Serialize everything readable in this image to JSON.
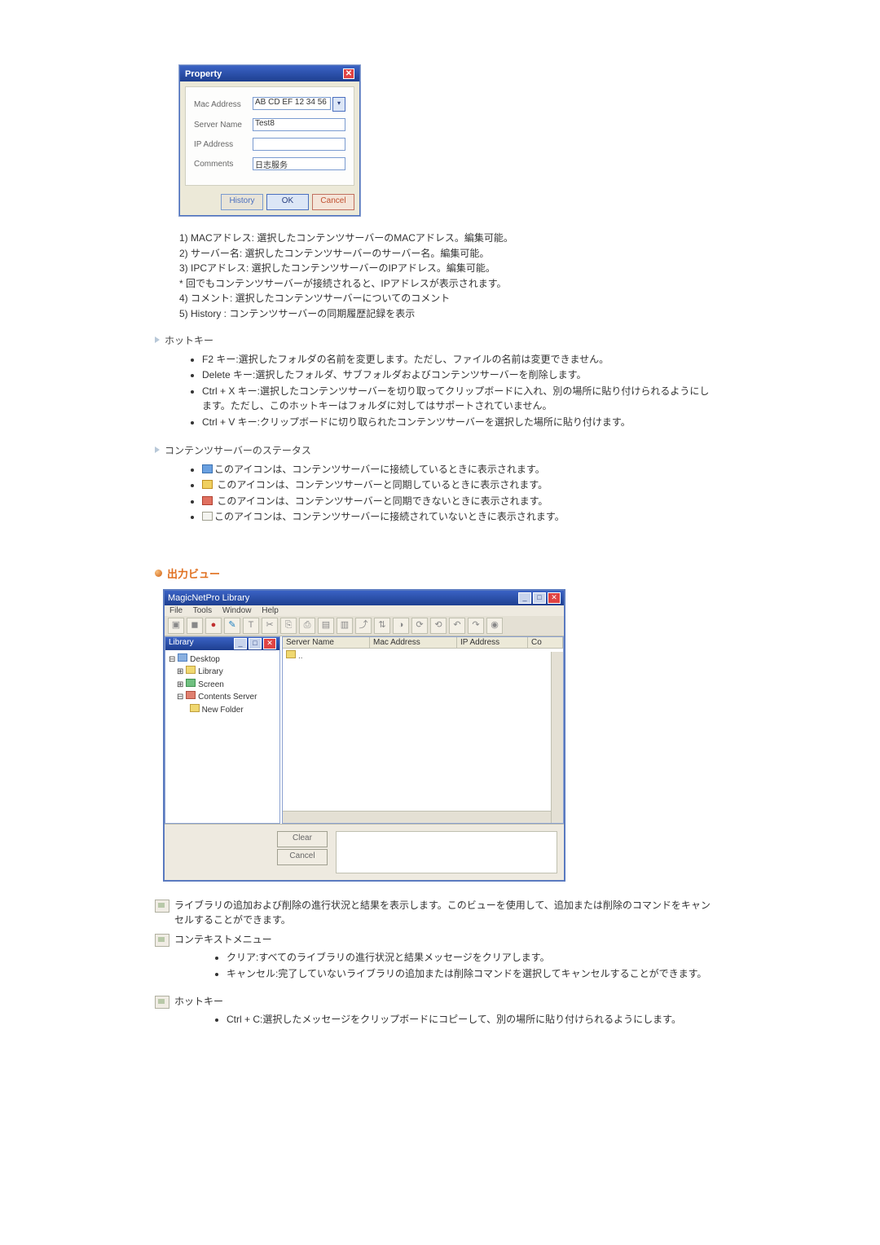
{
  "property_dialog": {
    "title": "Property",
    "rows": {
      "mac_label": "Mac Address",
      "mac_value": "AB CD EF 12 34 56",
      "server_label": "Server Name",
      "server_value": "Test8",
      "ip_label": "IP Address",
      "ip_value": "",
      "comments_label": "Comments",
      "comments_value": "日志服务"
    },
    "buttons": {
      "history": "History",
      "ok": "OK",
      "cancel": "Cancel"
    }
  },
  "property_notes": {
    "n1": "1) MACアドレス: 選択したコンテンツサーバーのMACアドレス。編集可能。",
    "n2": "2) サーバー名: 選択したコンテンツサーバーのサーバー名。編集可能。",
    "n3": "3) IPCアドレス: 選択したコンテンツサーバーのIPアドレス。編集可能。",
    "n3s": "* 回でもコンテンツサーバーが接続されると、IPアドレスが表示されます。",
    "n4": "4) コメント: 選択したコンテンツサーバーについてのコメント",
    "n5": "5) History : コンテンツサーバーの同期履歴記録を表示"
  },
  "hotkey1": {
    "head": "ホットキー",
    "i1": "F2 キー:選択したフォルダの名前を変更します。ただし、ファイルの名前は変更できません。",
    "i2": "Delete キー:選択したフォルダ、サブフォルダおよびコンテンツサーバーを削除します。",
    "i3": "Ctrl + X キー:選択したコンテンツサーバーを切り取ってクリップボードに入れ、別の場所に貼り付けられるようにします。ただし、このホットキーはフォルダに対してはサポートされていません。",
    "i4": "Ctrl + V キー:クリップボードに切り取られたコンテンツサーバーを選択した場所に貼り付けます。"
  },
  "status": {
    "head": "コンテンツサーバーのステータス",
    "s1": "このアイコンは、コンテンツサーバーに接続しているときに表示されます。",
    "s2": "このアイコンは、コンテンツサーバーと同期しているときに表示されます。",
    "s3": "このアイコンは、コンテンツサーバーと同期できないときに表示されます。",
    "s4": "このアイコンは、コンテンツサーバーに接続されていないときに表示されます。"
  },
  "output_view": {
    "heading": "出力ビュー"
  },
  "library_window": {
    "title": "MagicNetPro Library",
    "menu": {
      "file": "File",
      "tools": "Tools",
      "window": "Window",
      "help": "Help"
    },
    "tree": {
      "title": "Library",
      "n0": "Desktop",
      "n1": "Library",
      "n2": "Screen",
      "n3": "Contents Server",
      "n4": "New Folder"
    },
    "cols": {
      "c1": "Server Name",
      "c2": "Mac Address",
      "c3": "IP Address",
      "c4": "Co"
    },
    "bottom": {
      "clear": "Clear",
      "cancel": "Cancel"
    }
  },
  "outdesc": {
    "p1": "ライブラリの追加および削除の進行状況と結果を表示します。このビューを使用して、追加または削除のコマンドをキャンセルすることができます。",
    "ctx_head": "コンテキストメニュー",
    "ctx1": "クリア:すべてのライブラリの進行状況と結果メッセージをクリアします。",
    "ctx2": "キャンセル:完了していないライブラリの追加または削除コマンドを選択してキャンセルすることができます。",
    "hk_head": "ホットキー",
    "hk1": "Ctrl + C:選択したメッセージをクリップボードにコピーして、別の場所に貼り付けられるようにします。"
  }
}
